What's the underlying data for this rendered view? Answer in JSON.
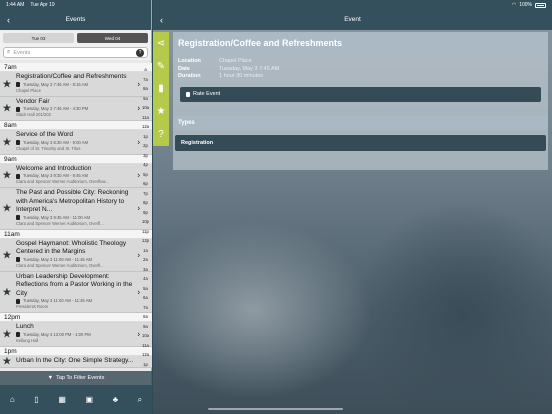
{
  "status": {
    "time": "1:44 AM",
    "date": "Tue Apr 19",
    "battery": "100%"
  },
  "left": {
    "title": "Events",
    "day_tabs": [
      "Tue 03",
      "Wed 04"
    ],
    "search_placeholder": "Events",
    "help": "?",
    "filter_label": "Tap To Filter Events"
  },
  "schedule": {
    "h7": "7am",
    "e1": {
      "title": "Registration/Coffee and Refreshments",
      "time": "Tuesday, May 3 7:45 AM - 9:15 AM",
      "location": "Chapel Place"
    },
    "e2": {
      "title": "Vendor Fair",
      "time": "Tuesday, May 3 7:45 AM - 4:30 PM",
      "location": "Slack Hall 201/202"
    },
    "h8": "8am",
    "e3": {
      "title": "Service of the Word",
      "time": "Tuesday, May 3 8:30 AM - 9:00 AM",
      "location": "Chapel of St. Timothy and St. Titus"
    },
    "h9": "9am",
    "e4": {
      "title": "Welcome and Introduction",
      "time": "Tuesday, May 3 9:30 AM - 9:45 AM",
      "location": "Clara and Spencer Werner Auditorium, Overflow..."
    },
    "e5": {
      "title": "The Past and Possible City: Reckoning with America's Metropolitan History to Interpret N...",
      "time": "Tuesday, May 3 9:45 AM - 11:00 AM",
      "location": "Clara and Spencer Werner Auditorium, Overfl..."
    },
    "h11": "11am",
    "e6": {
      "title": "Gospel Haymanot: Wholistic Theology Centered in the Margins",
      "time": "Tuesday, May 3 11:00 AM - 11:45 AM",
      "location": "Clara and Spencer Werner Auditorium, Overfl..."
    },
    "e7": {
      "title": "Urban Leadership Development: Reflections from a Pastor Working in the City",
      "time": "Tuesday, May 3 11:00 AM - 11:45 AM",
      "location": "Presidents Room"
    },
    "h12": "12pm",
    "e8": {
      "title": "Lunch",
      "time": "Tuesday, May 3 12:00 PM - 1:00 PM",
      "location": "Kellung Hall"
    },
    "h13": "1pm",
    "e9": {
      "title": "Urban In the City: One Simple Strategy...",
      "time": "",
      "location": ""
    }
  },
  "index_letters": [
    "a",
    "7a",
    "8a",
    "9a",
    "10a",
    "11a",
    "12a",
    "1p",
    "2p",
    "3p",
    "4p",
    "5p",
    "6p",
    "7p",
    "8p",
    "9p",
    "10p",
    "11p",
    "12p",
    "1a",
    "2a",
    "3a",
    "4a",
    "5a",
    "6a",
    "7a",
    "8a",
    "9a",
    "10a",
    "11a",
    "12a",
    "1p"
  ],
  "right": {
    "title": "Event",
    "event_title": "Registration/Coffee and Refreshments",
    "location_label": "Location",
    "location_value": "Chapel Place",
    "date_label": "Date",
    "date_value": "Tuesday, May 3 7:45 AM",
    "duration_label": "Duration",
    "duration_value": "1 hour 30 minutes",
    "rate_label": "Rate Event",
    "types_title": "Types",
    "type_item": "Registration"
  },
  "colors": {
    "header": "#35505d",
    "accent": "#b5c94a",
    "button": "#344c58"
  }
}
